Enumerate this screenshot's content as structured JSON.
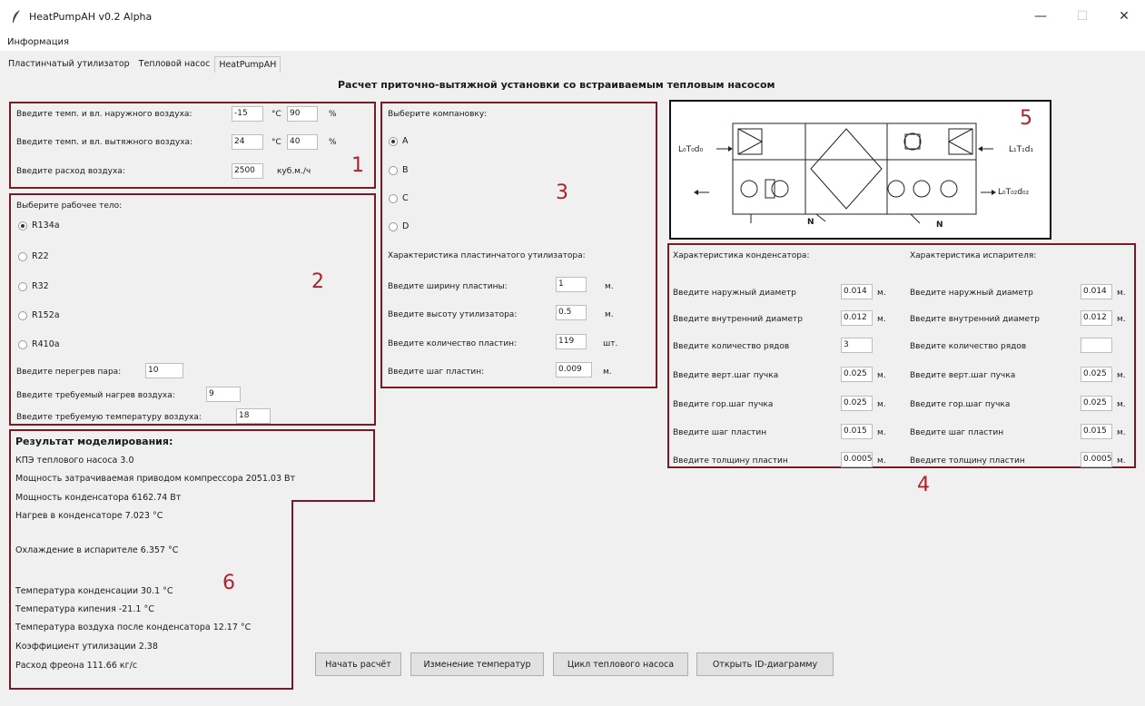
{
  "window": {
    "title": "HeatPumpAH v0.2 Alpha",
    "minimize": "—",
    "maximize": "☐",
    "close": "✕"
  },
  "menu": {
    "info": "Информация"
  },
  "tabs": [
    "Пластинчатый утилизатор",
    "Тепловой насос",
    "HeatPumpAH"
  ],
  "heading": "Расчет приточно-вытяжной установки со встраиваемым тепловым насосом",
  "section1": {
    "number": "1",
    "outdoor_label": "Введите темп. и вл. наружного воздуха:",
    "outdoor_temp": "-15",
    "outdoor_hum": "90",
    "exhaust_label": "Введите темп. и вл. вытяжного воздуха:",
    "exhaust_temp": "24",
    "exhaust_hum": "40",
    "unit_c": "°C",
    "unit_pct": "%",
    "flow_label": "Введите расход воздуха:",
    "flow_value": "2500",
    "flow_unit": "куб.м./ч"
  },
  "section2": {
    "number": "2",
    "title": "Выберите рабочее тело:",
    "refrigerants": [
      "R134a",
      "R22",
      "R32",
      "R152a",
      "R410a"
    ],
    "selected": "R134a",
    "superheat_label": "Введите перегрев пара:",
    "superheat_value": "10",
    "heating_label": "Введите требуемый нагрев воздуха:",
    "heating_value": "9",
    "temp_label": "Введите требуемую температуру воздуха:",
    "temp_value": "18"
  },
  "section3": {
    "number": "3",
    "title": "Выберите компановку:",
    "layouts": [
      "A",
      "B",
      "C",
      "D"
    ],
    "selected": "A",
    "char_title": "Характеристика пластинчатого утилизатора:",
    "width_label": "Введите ширину пластины:",
    "width_value": "1",
    "width_unit": "м.",
    "height_label": "Введите высоту утилизатора:",
    "height_value": "0.5",
    "height_unit": "м.",
    "count_label": "Введите количество пластин:",
    "count_value": "119",
    "count_unit": "шт.",
    "pitch_label": "Введите шаг пластин:",
    "pitch_value": "0.009",
    "pitch_unit": "м."
  },
  "section4": {
    "number": "4",
    "condenser_title": "Характеристика конденсатора:",
    "evaporator_title": "Характеристика испарителя:",
    "rows": [
      {
        "label": "Введите наружный диаметр",
        "cond": "0.014",
        "evap": "0.014",
        "unit": "м."
      },
      {
        "label": "Введите внутренний диаметр",
        "cond": "0.012",
        "evap": "0.012",
        "unit": "м."
      },
      {
        "label": "Введите количество рядов",
        "cond": "3",
        "evap": "",
        "unit": ""
      },
      {
        "label": "Введите верт.шаг пучка",
        "cond": "0.025",
        "evap": "0.025",
        "unit": "м."
      },
      {
        "label": "Введите гор.шаг пучка",
        "cond": "0.025",
        "evap": "0.025",
        "unit": "м."
      },
      {
        "label": "Введите шаг пластин",
        "cond": "0.015",
        "evap": "0.015",
        "unit": "м."
      },
      {
        "label": "Введите толщину пластин",
        "cond": "0.0005",
        "evap": "0.0005",
        "unit": "м."
      }
    ]
  },
  "section5": {
    "number": "5",
    "in_left": "L₀T₀d₀",
    "in_right": "L₁T₁d₁",
    "out_right": "L₀T₀₂d₀₂",
    "n_left": "N",
    "n_right": "N"
  },
  "section6": {
    "number": "6",
    "title": "Результат моделирования:",
    "lines": [
      "КПЭ теплового насоса 3.0",
      "Мощность затрачиваемая приводом компрессора 2051.03 Вт",
      "Мощность конденсатора 6162.74 Вт",
      "Нагрев в конденсаторе 7.023 °C",
      "Охлаждение в испарителе 6.357 °C",
      "Температура конденсации 30.1 °C",
      "Температура кипения -21.1 °C",
      "Температура воздуха после конденсатора 12.17 °C",
      "Коэффициент утилизации 2.38",
      "Расход фреона 111.66 кг/с"
    ]
  },
  "buttons": {
    "start": "Начать расчёт",
    "temps": "Изменение температур",
    "cycle": "Цикл теплового насоса",
    "id_diagram": "Открыть ID-диаграмму"
  },
  "colors": {
    "frame": "#7a1a26",
    "number": "#b11f2a"
  }
}
